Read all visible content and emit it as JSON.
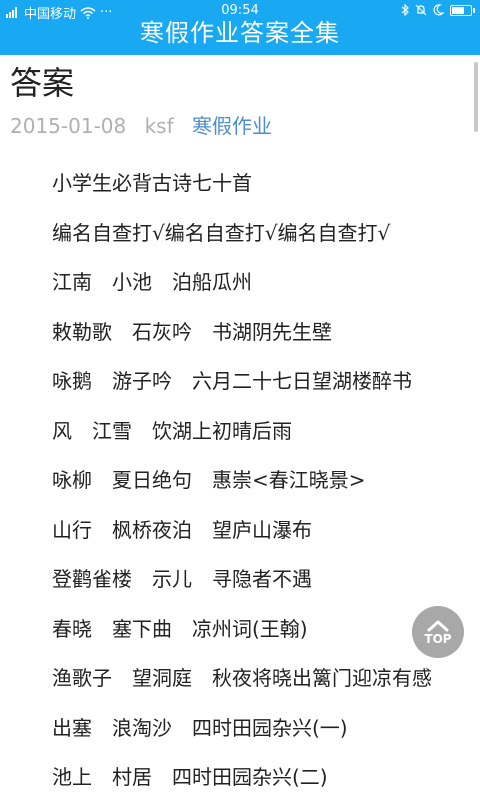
{
  "status_bar": {
    "carrier": "中国移动",
    "time": "09:54"
  },
  "header": {
    "title": "寒假作业答案全集"
  },
  "article": {
    "title": "答案",
    "date": "2015-01-08",
    "author": "ksf",
    "category": "寒假作业"
  },
  "poems": [
    "小学生必背古诗七十首",
    "编名自查打√编名自查打√编名自查打√",
    "江南　小池　泊船瓜州",
    "敕勒歌　石灰吟　书湖阴先生壁",
    "咏鹅　游子吟　六月二十七日望湖楼醉书",
    "风　江雪　饮湖上初晴后雨",
    "咏柳　夏日绝句　惠崇<春江晓景>",
    "山行　枫桥夜泊　望庐山瀑布",
    "登鹳雀楼　示儿　寻隐者不遇",
    "春晓　塞下曲　凉州词(王翰)",
    "渔歌子　望洞庭　秋夜将晓出篱门迎凉有感",
    "出塞　浪淘沙　四时田园杂兴(一)",
    "池上　村居　四时田园杂兴(二)"
  ],
  "top_button": {
    "label": "TOP"
  }
}
